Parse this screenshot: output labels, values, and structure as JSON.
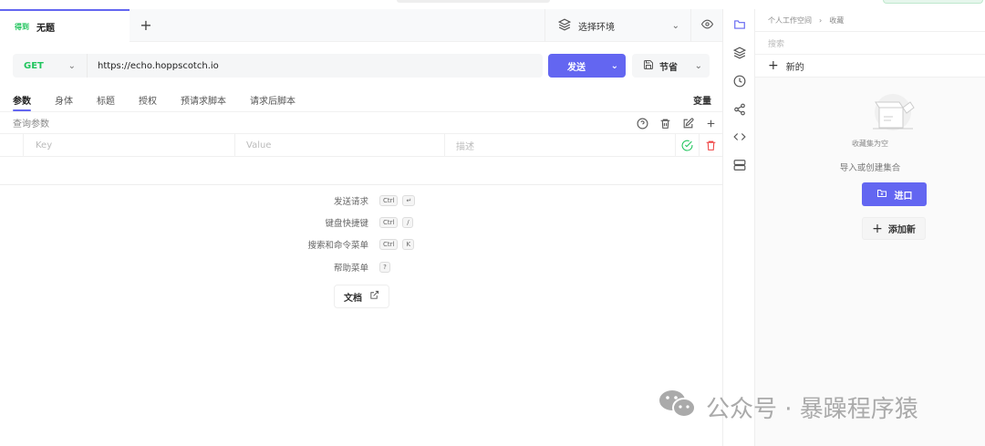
{
  "tabs": [
    {
      "method": "得到",
      "title": "无题"
    }
  ],
  "new_tab": "+",
  "environment": {
    "label": "选择环境"
  },
  "request": {
    "method": "GET",
    "url": "https://echo.hoppscotch.io",
    "send": "发送",
    "save": "节省"
  },
  "request_tabs": [
    "参数",
    "身体",
    "标题",
    "授权",
    "预请求脚本",
    "请求后脚本"
  ],
  "variables": "变量",
  "query": {
    "title": "查询参数",
    "columns": [
      "Key",
      "Value",
      "描述"
    ]
  },
  "shortcuts": [
    {
      "label": "发送请求",
      "keys": [
        "Ctrl",
        "↵"
      ]
    },
    {
      "label": "键盘快捷键",
      "keys": [
        "Ctrl",
        "/"
      ]
    },
    {
      "label": "搜索和命令菜单",
      "keys": [
        "Ctrl",
        "K"
      ]
    },
    {
      "label": "帮助菜单",
      "keys": [
        "?"
      ]
    }
  ],
  "docs": "文档",
  "sidebar": {
    "breadcrumb": [
      "个人工作空间",
      "收藏"
    ],
    "search_placeholder": "搜索",
    "new": "新的",
    "empty": "收藏集为空",
    "hint": "导入或创建集合",
    "import": "进口",
    "add_new": "添加新"
  },
  "watermark": "公众号 · 暴躁程序猿",
  "colors": {
    "accent": "#6366f1",
    "get": "#22c55e",
    "danger": "#ef4444"
  }
}
